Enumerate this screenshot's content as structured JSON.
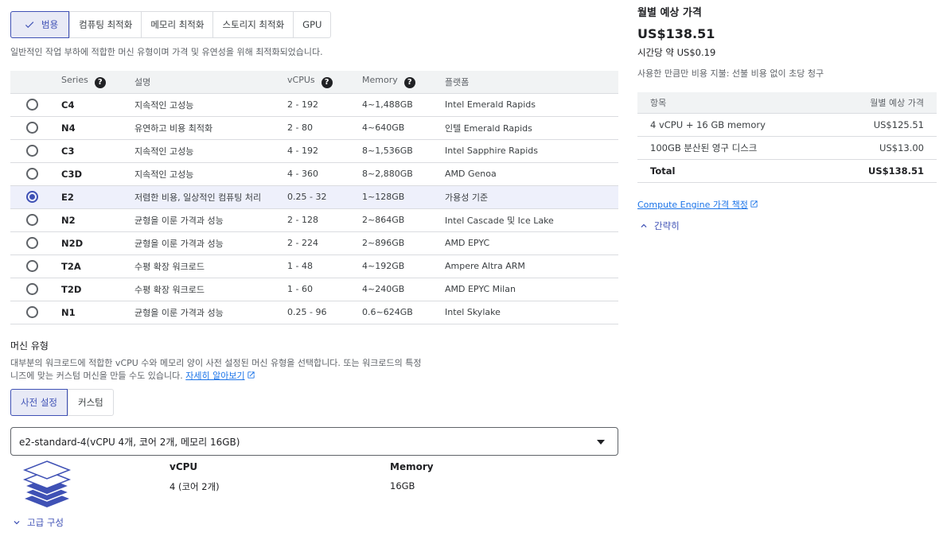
{
  "family_tabs": [
    {
      "label": "범용",
      "active": true
    },
    {
      "label": "컴퓨팅 최적화",
      "active": false
    },
    {
      "label": "메모리 최적화",
      "active": false
    },
    {
      "label": "스토리지 최적화",
      "active": false
    },
    {
      "label": "GPU",
      "active": false
    }
  ],
  "family_description": "일반적인 작업 부하에 적합한 머신 유형이며 가격 및 유연성을 위해 최적화되었습니다.",
  "series_table": {
    "headers": {
      "series": "Series",
      "description": "설명",
      "vcpus": "vCPUs",
      "memory": "Memory",
      "platform": "플랫폼"
    },
    "selected_index": 4,
    "rows": [
      {
        "series": "C4",
        "description": "지속적인 고성능",
        "vcpus": "2 - 192",
        "memory": "4~1,488GB",
        "platform": "Intel Emerald Rapids"
      },
      {
        "series": "N4",
        "description": "유연하고 비용 최적화",
        "vcpus": "2 - 80",
        "memory": "4~640GB",
        "platform": "인텔 Emerald Rapids"
      },
      {
        "series": "C3",
        "description": "지속적인 고성능",
        "vcpus": "4 - 192",
        "memory": "8~1,536GB",
        "platform": "Intel Sapphire Rapids"
      },
      {
        "series": "C3D",
        "description": "지속적인 고성능",
        "vcpus": "4 - 360",
        "memory": "8~2,880GB",
        "platform": "AMD Genoa"
      },
      {
        "series": "E2",
        "description": "저렴한 비용, 일상적인 컴퓨팅 처리",
        "vcpus": "0.25 - 32",
        "memory": "1~128GB",
        "platform": "가용성 기준"
      },
      {
        "series": "N2",
        "description": "균형을 이룬 가격과 성능",
        "vcpus": "2 - 128",
        "memory": "2~864GB",
        "platform": "Intel Cascade 및 Ice Lake"
      },
      {
        "series": "N2D",
        "description": "균형을 이룬 가격과 성능",
        "vcpus": "2 - 224",
        "memory": "2~896GB",
        "platform": "AMD EPYC"
      },
      {
        "series": "T2A",
        "description": "수평 확장 워크로드",
        "vcpus": "1 - 48",
        "memory": "4~192GB",
        "platform": "Ampere Altra ARM"
      },
      {
        "series": "T2D",
        "description": "수평 확장 워크로드",
        "vcpus": "1 - 60",
        "memory": "4~240GB",
        "platform": "AMD EPYC Milan"
      },
      {
        "series": "N1",
        "description": "균형을 이룬 가격과 성능",
        "vcpus": "0.25 - 96",
        "memory": "0.6~624GB",
        "platform": "Intel Skylake"
      }
    ]
  },
  "machine_type": {
    "title": "머신 유형",
    "description": "대부분의 워크로드에 적합한 vCPU 수와 메모리 양이 사전 설정된 머신 유형을 선택합니다. 또는 워크로드의 특정 니즈에 맞는 커스텀 머신을 만들 수도 있습니다.",
    "learn_more": "자세히 알아보기",
    "tabs": [
      {
        "label": "사전 설정",
        "active": true
      },
      {
        "label": "커스텀",
        "active": false
      }
    ],
    "selected": "e2-standard-4(vCPU 4개, 코어 2개, 메모리 16GB)",
    "vcpu_label": "vCPU",
    "vcpu_value": "4 (코어 2개)",
    "memory_label": "Memory",
    "memory_value": "16GB",
    "advanced_toggle": "고급 구성"
  },
  "pricing": {
    "title": "월별 예상 가격",
    "total": "US$138.51",
    "hourly": "시간당 약 US$0.19",
    "note": "사용한 만큼만 비용 지불: 선불 비용 없이 초당 청구",
    "table_headers": {
      "item": "항목",
      "amount": "월별 예상 가격"
    },
    "rows": [
      {
        "item": "4 vCPU + 16 GB memory",
        "amount": "US$125.51"
      },
      {
        "item": "100GB 분산된 영구 디스크",
        "amount": "US$13.00"
      }
    ],
    "total_row": {
      "item": "Total",
      "amount": "US$138.51"
    },
    "pricing_link": "Compute Engine 가격 책정",
    "collapse_toggle": "간략히"
  },
  "colors": {
    "accent": "#3f51b5",
    "link": "#1a73e8",
    "selected_row": "#eef0fb"
  }
}
